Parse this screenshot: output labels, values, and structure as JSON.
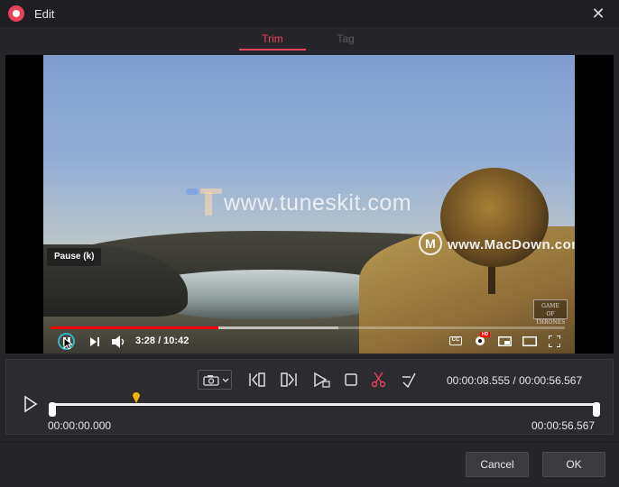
{
  "window": {
    "title": "Edit",
    "close_icon": "close-icon",
    "accent": "#e9415a"
  },
  "tabs": [
    {
      "label": "Trim",
      "active": true
    },
    {
      "label": "Tag",
      "active": false
    }
  ],
  "video": {
    "watermarks": {
      "tuneskit": "www.tuneskit.com",
      "macdown": "www.MacDown.com",
      "got_logo_line1": "GAME",
      "got_logo_line2": "OF",
      "got_logo_line3": "THRONES"
    },
    "tooltip": "Pause (k)",
    "time": "3:28 / 10:42",
    "played_fraction": 0.326,
    "buffered_fraction": 0.56,
    "controls": [
      "pause-icon",
      "next-icon",
      "volume-icon",
      "captions-icon",
      "settings-icon",
      "miniplayer-icon",
      "theater-icon",
      "fullscreen-icon"
    ],
    "cc_label": "CC",
    "hd_label": "HD"
  },
  "toolbar": {
    "icons": [
      "camera-icon",
      "set-start-icon",
      "set-end-icon",
      "preview-segment-icon",
      "stop-icon",
      "cut-icon",
      "restore-icon"
    ],
    "time_readout": "00:00:08.555 / 00:00:56.567"
  },
  "timeline": {
    "start_time": "00:00:00.000",
    "end_time": "00:00:56.567",
    "playhead_fraction": 0.154,
    "playhead_color": "#f2b600"
  },
  "footer": {
    "cancel_label": "Cancel",
    "ok_label": "OK"
  }
}
